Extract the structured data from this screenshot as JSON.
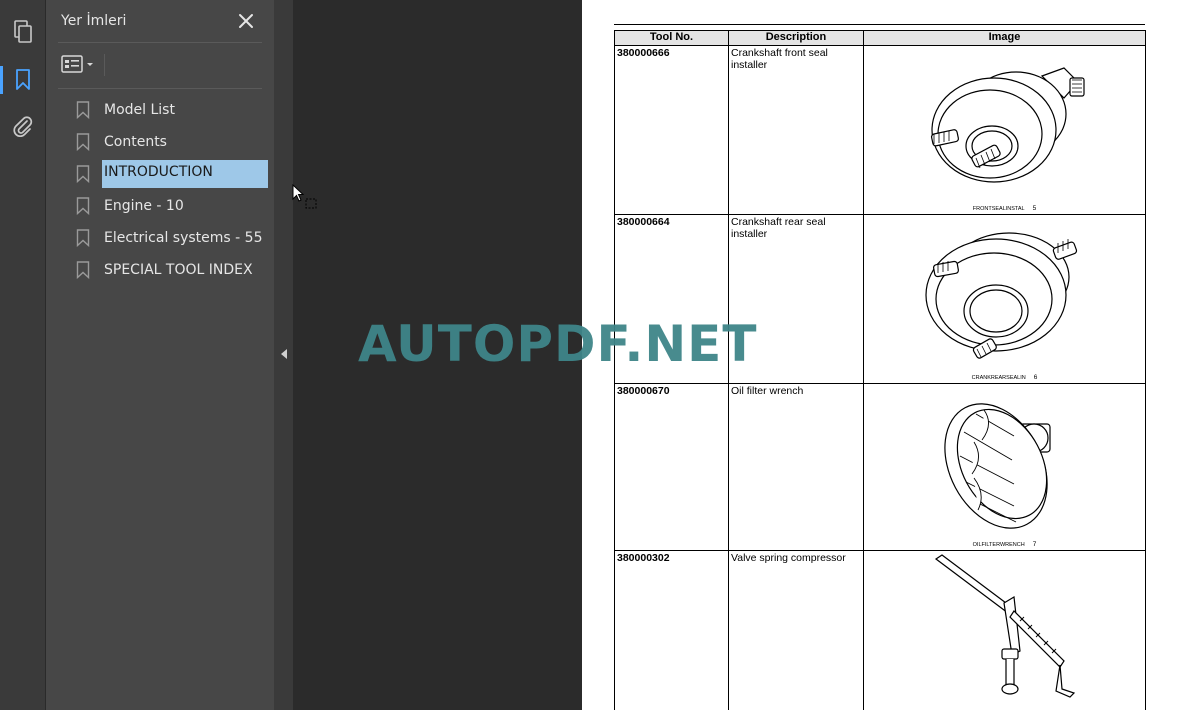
{
  "sidebar": {
    "panel_title": "Yer İmleri",
    "bookmarks": [
      {
        "label": "Model List"
      },
      {
        "label": "Contents"
      },
      {
        "label": "INTRODUCTION"
      },
      {
        "label": "Engine - 10"
      },
      {
        "label": "Electrical systems - 55"
      },
      {
        "label": "SPECIAL TOOL INDEX"
      }
    ],
    "selected_index": 2
  },
  "rail": {
    "icons": [
      "pages-icon",
      "bookmark-icon",
      "attachment-icon"
    ],
    "active": "bookmark-icon"
  },
  "document": {
    "table_headers": [
      "Tool No.",
      "Description",
      "Image"
    ],
    "rows": [
      {
        "tool_no": "380000666",
        "description": "Crankshaft front seal installer",
        "caption": "FRONTSEALINSTAL",
        "fig": "5"
      },
      {
        "tool_no": "380000664",
        "description": "Crankshaft rear seal installer",
        "caption": "CRANKREARSEALIN",
        "fig": "6"
      },
      {
        "tool_no": "380000670",
        "description": "Oil filter wrench",
        "caption": "OILFILTERWRENCH",
        "fig": "7"
      },
      {
        "tool_no": "380000302",
        "description": "Valve spring compressor",
        "caption": "",
        "fig": ""
      }
    ]
  },
  "watermark": "AUTOPDF.NET",
  "colors": {
    "accent": "#4aa3ff",
    "selection": "#9ec8e8",
    "watermark": "#3f8589",
    "panel_bg": "#474747",
    "viewer_bg": "#2b2b2b"
  }
}
